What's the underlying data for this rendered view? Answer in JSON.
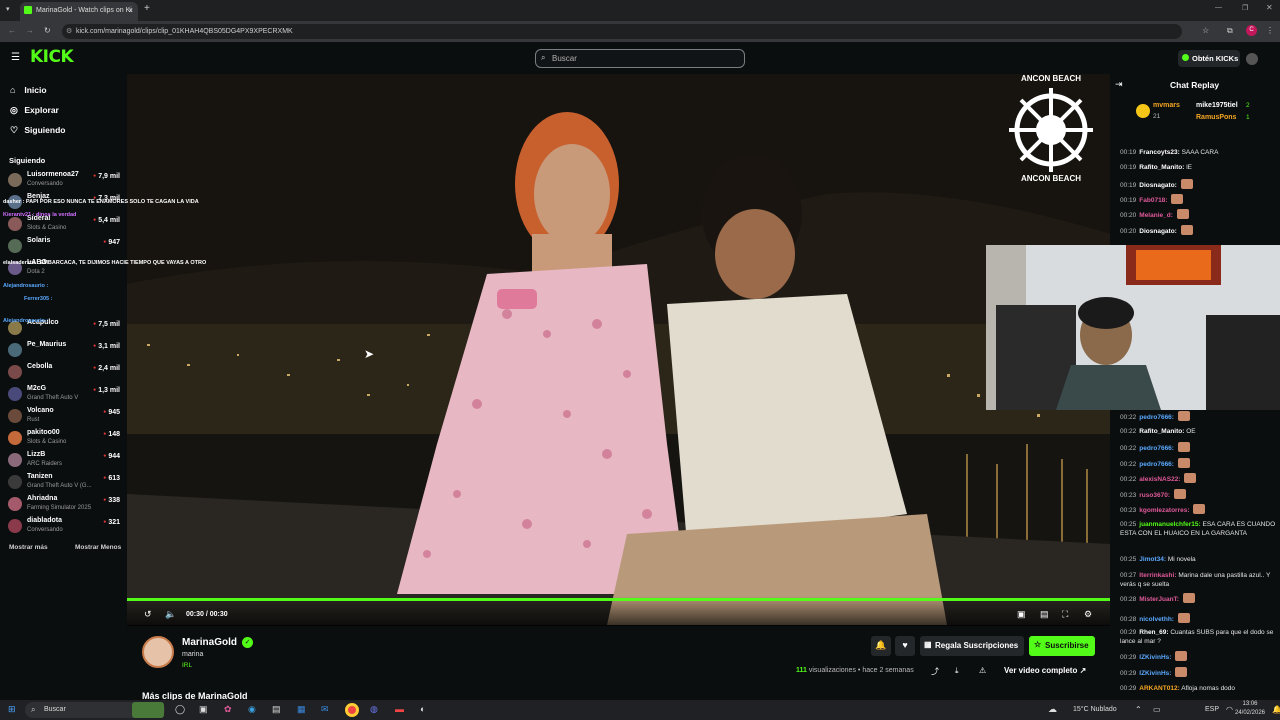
{
  "browser": {
    "tab_title": "MarinaGold - Watch clips on Ki",
    "url": "kick.com/marinagold/clips/clip_01KHAH4QBS05DG4PX9XPECRXMK",
    "new_tab": "+"
  },
  "header": {
    "logo": "KICK",
    "search_placeholder": "Buscar",
    "kicks_button": "Obtén KICKs"
  },
  "sidebar": {
    "nav": [
      {
        "label": "Inicio",
        "icon": "home-icon"
      },
      {
        "label": "Explorar",
        "icon": "compass-icon"
      },
      {
        "label": "Siguiendo",
        "icon": "heart-icon"
      }
    ],
    "section_title": "Siguiendo",
    "channels": [
      {
        "name": "Luisormenoa27",
        "category": "Conversando",
        "viewers": "7,9 mil",
        "color": "#7a6a5a"
      },
      {
        "name": "Benjaz",
        "category": "",
        "viewers": "7,3 mil",
        "color": "#5a6f8a"
      },
      {
        "name": "Sideral",
        "category": "Slots & Casino",
        "viewers": "5,4 mil",
        "color": "#8a5a5a"
      },
      {
        "name": "Solaris",
        "category": "",
        "viewers": "947",
        "color": "#556b55"
      },
      {
        "name": "LABO",
        "category": "Dota 2",
        "viewers": "",
        "color": "#6a5a8a"
      },
      {
        "name": "Acapulco",
        "category": "",
        "viewers": "7,5 mil",
        "color": "#8a7a4a"
      },
      {
        "name": "Pe_Maurius",
        "category": "",
        "viewers": "3,1 mil",
        "color": "#4a6a7a"
      },
      {
        "name": "Cebolla",
        "category": "",
        "viewers": "2,4 mil",
        "color": "#7a4a4a"
      },
      {
        "name": "M2cG",
        "category": "Grand Theft Auto V",
        "viewers": "1,3 mil",
        "color": "#4a4a7a"
      },
      {
        "name": "Volcano",
        "category": "Rust",
        "viewers": "945",
        "color": "#6a4a3a"
      },
      {
        "name": "pakitoo00",
        "category": "Slots & Casino",
        "viewers": "148",
        "color": "#c46a3a"
      },
      {
        "name": "LizzB",
        "category": "ARC Raiders",
        "viewers": "944",
        "color": "#8a6a7a"
      },
      {
        "name": "Tanizen",
        "category": "Grand Theft Auto V (G...",
        "viewers": "613",
        "color": "#3a3a3a"
      },
      {
        "name": "Ahriadna",
        "category": "Farming Simulator 2025",
        "viewers": "338",
        "color": "#a45a6a"
      },
      {
        "name": "diabladota",
        "category": "Conversando",
        "viewers": "321",
        "color": "#8a3a4a"
      }
    ],
    "show_more": "Mostrar más",
    "show_less": "Mostrar Menos",
    "overlay_chat": [
      "Kierantv21 : dinos la verdad",
      "dasher : PAPI POR ESO NUNCA TE ENAMORES SOLO TE CAGAN LA VIDA",
      "elalsadersta : EMBARCACA, TE DIJIMOS HACIE TIEMPO QUE VAYAS A OTRO",
      "Alejandrosaurio :",
      "Ferrer305 :",
      "Alejandrosaurio :"
    ]
  },
  "video": {
    "watermark_top": "ANCON BEACH",
    "watermark_bottom": "ANCON BEACH",
    "timecode": "00:30 / 00:30",
    "progress": 1.0
  },
  "chat": {
    "title": "Chat Replay",
    "top_gifters": [
      {
        "name": "mvmars",
        "count": "21"
      },
      {
        "name": "mike1975tiel",
        "count": "2"
      },
      {
        "name": "RamusPons",
        "count": "1"
      }
    ],
    "messages_top": [
      {
        "time": "00:19",
        "user": "Francoyts23:",
        "text": "SAAA CARA",
        "color": "#ffffff"
      },
      {
        "time": "00:19",
        "user": "Rafito_Manito:",
        "text": "lE",
        "color": "#ffffff"
      },
      {
        "time": "00:19",
        "user": "Diosnagato:",
        "text": "",
        "color": "#ffffff"
      },
      {
        "time": "00:19",
        "user": "Fab0718:",
        "text": "",
        "color": "#e05a9a"
      },
      {
        "time": "00:20",
        "user": "Melanie_d:",
        "text": "",
        "color": "#e05a9a"
      },
      {
        "time": "00:20",
        "user": "Diosnagato:",
        "text": "",
        "color": "#ffffff"
      }
    ],
    "messages_bottom": [
      {
        "time": "00:22",
        "user": "pedro7666:",
        "text": "",
        "color": "#5aa9ff"
      },
      {
        "time": "00:22",
        "user": "Rafito_Manito:",
        "text": "OE",
        "color": "#ffffff"
      },
      {
        "time": "00:22",
        "user": "pedro7666:",
        "text": "",
        "color": "#5aa9ff"
      },
      {
        "time": "00:22",
        "user": "pedro7666:",
        "text": "",
        "color": "#5aa9ff"
      },
      {
        "time": "00:22",
        "user": "alexisNAS22:",
        "text": "",
        "color": "#e05a9a"
      },
      {
        "time": "00:23",
        "user": "ruso3670:",
        "text": "",
        "color": "#e05a9a"
      },
      {
        "time": "00:23",
        "user": "kgomlezatorres:",
        "text": "",
        "color": "#e05a9a"
      },
      {
        "time": "00:25",
        "user": "juanmanuelchfer15:",
        "text": "ESA CARA ES CUANDO ESTA CON EL HUAICO EN LA GARGANTA",
        "color": "#53fc18"
      },
      {
        "time": "00:25",
        "user": "Jimot34:",
        "text": "Mi novela",
        "color": "#5aa9ff"
      },
      {
        "time": "00:27",
        "user": "Iterrinkashi:",
        "text": "Marina dale una pastilla azul.. Y verás q se suelta",
        "color": "#e05a9a"
      },
      {
        "time": "00:28",
        "user": "MisterJuanT:",
        "text": "",
        "color": "#e05a9a"
      },
      {
        "time": "00:28",
        "user": "nicolvethh:",
        "text": "",
        "color": "#5aa9ff"
      },
      {
        "time": "00:29",
        "user": "Rhen_69:",
        "text": "Cuantas SUBS para que el dodo se lance al mar ?",
        "color": "#ffffff"
      },
      {
        "time": "00:29",
        "user": "IZKivinHs:",
        "text": "",
        "color": "#5aa9ff"
      },
      {
        "time": "00:29",
        "user": "IZKivinHs:",
        "text": "",
        "color": "#5aa9ff"
      },
      {
        "time": "00:29",
        "user": "ARKANT012:",
        "text": "Afloja nomas dodo",
        "color": "#f5a623"
      }
    ]
  },
  "channel": {
    "name": "MarinaGold",
    "subtitle": "marina",
    "category": "IRL",
    "views": "111",
    "views_label": "visualizaciones",
    "time_ago": "hace 2 semanas",
    "gift_button": "Regala Suscripciones",
    "subscribe_button": "Suscribirse",
    "full_video_button": "Ver video completo",
    "more_clips": "Más clips de MarinaGold"
  },
  "taskbar": {
    "search": "Buscar",
    "weather": "15°C  Nublado",
    "lang": "ESP",
    "time": "13:06",
    "date": "24/02/2026"
  },
  "colors": {
    "brand_green": "#53fc18",
    "background": "#0b0e0f"
  }
}
